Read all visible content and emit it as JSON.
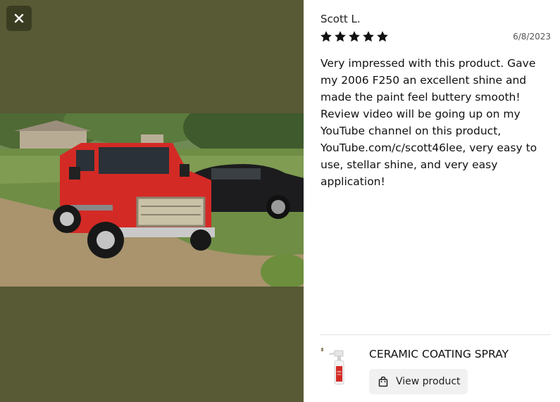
{
  "review": {
    "reviewer": "Scott L.",
    "date": "6/8/2023",
    "rating": 5,
    "body": "Very impressed with this product. Gave my 2006 F250 an excellent shine and made the paint feel buttery smooth! Review video will be going up on my YouTube channel on this product, YouTube.com/c/scott46lee, very easy to use, stellar shine, and very easy application!"
  },
  "product": {
    "name": "CERAMIC COATING SPRAY",
    "view_label": "View product"
  },
  "icons": {
    "close": "close-icon",
    "star": "star-icon",
    "bag": "shopping-bag-icon"
  },
  "colors": {
    "backdrop": "#575a34",
    "star": "#111111",
    "truck": "#d42a25"
  }
}
